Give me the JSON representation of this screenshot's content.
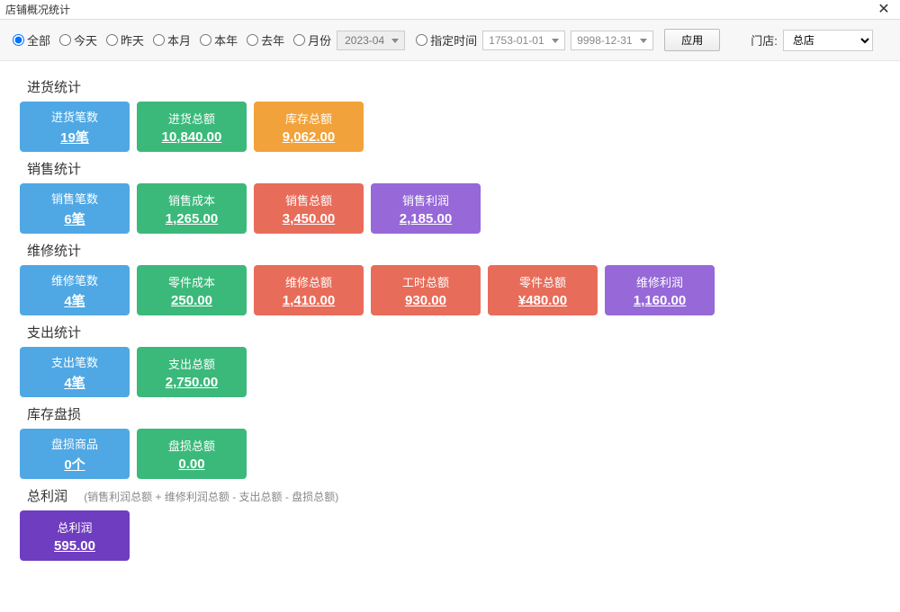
{
  "window_title": "店铺概况统计",
  "filter": {
    "radios": [
      "全部",
      "今天",
      "昨天",
      "本月",
      "本年",
      "去年",
      "月份"
    ],
    "selected_radio": "全部",
    "month_value": "2023-04",
    "custom_time_label": "指定时间",
    "date_from": "1753-01-01",
    "date_to": "9998-12-31",
    "apply_label": "应用",
    "store_label": "门店:",
    "store_value": "总店"
  },
  "sections": {
    "purchase": {
      "title": "进货统计",
      "cards": [
        {
          "label": "进货笔数",
          "value": "19笔",
          "color": "blue"
        },
        {
          "label": "进货总额",
          "value": "10,840.00",
          "color": "green"
        },
        {
          "label": "库存总额",
          "value": "9,062.00",
          "color": "orange"
        }
      ]
    },
    "sales": {
      "title": "销售统计",
      "cards": [
        {
          "label": "销售笔数",
          "value": "6笔",
          "color": "blue"
        },
        {
          "label": "销售成本",
          "value": "1,265.00",
          "color": "green"
        },
        {
          "label": "销售总额",
          "value": "3,450.00",
          "color": "red"
        },
        {
          "label": "销售利润",
          "value": "2,185.00",
          "color": "purple"
        }
      ]
    },
    "repair": {
      "title": "维修统计",
      "cards": [
        {
          "label": "维修笔数",
          "value": "4笔",
          "color": "blue"
        },
        {
          "label": "零件成本",
          "value": "250.00",
          "color": "green"
        },
        {
          "label": "维修总额",
          "value": "1,410.00",
          "color": "red"
        },
        {
          "label": "工时总额",
          "value": "930.00",
          "color": "red"
        },
        {
          "label": "零件总额",
          "value": "¥480.00",
          "color": "red"
        },
        {
          "label": "维修利润",
          "value": "1,160.00",
          "color": "purple"
        }
      ]
    },
    "expense": {
      "title": "支出统计",
      "cards": [
        {
          "label": "支出笔数",
          "value": "4笔",
          "color": "blue"
        },
        {
          "label": "支出总额",
          "value": "2,750.00",
          "color": "green"
        }
      ]
    },
    "loss": {
      "title": "库存盘损",
      "cards": [
        {
          "label": "盘损商品",
          "value": "0个",
          "color": "blue"
        },
        {
          "label": "盘损总额",
          "value": "0.00",
          "color": "green"
        }
      ]
    },
    "profit": {
      "title": "总利润",
      "formula": "(销售利润总额 + 维修利润总额 - 支出总额 - 盘损总额)",
      "cards": [
        {
          "label": "总利润",
          "value": "595.00",
          "color": "deep-purple"
        }
      ]
    }
  }
}
